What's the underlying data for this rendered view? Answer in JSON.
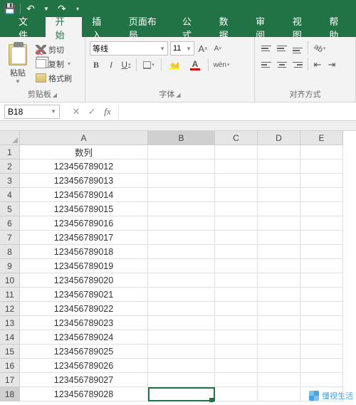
{
  "titlebar": {
    "save_icon": "💾",
    "undo_icon": "↶",
    "redo_icon": "↷"
  },
  "tabs": {
    "file": "文件",
    "home": "开始",
    "insert": "插入",
    "page_layout": "页面布局",
    "formulas": "公式",
    "data": "数据",
    "review": "审阅",
    "view": "视图",
    "help": "帮助"
  },
  "ribbon": {
    "clipboard": {
      "paste": "粘贴",
      "cut": "剪切",
      "copy": "复制",
      "format_painter": "格式刷",
      "label": "剪贴板"
    },
    "font": {
      "name": "等线",
      "size": "11",
      "label": "字体",
      "increase": "A",
      "decrease": "A",
      "bold": "B",
      "italic": "I",
      "underline": "U",
      "phonetic": "wén"
    },
    "alignment": {
      "label": "对齐方式"
    }
  },
  "namebox": "B18",
  "formula_bar": "",
  "grid": {
    "columns": [
      "A",
      "B",
      "C",
      "D",
      "E"
    ],
    "row_numbers": [
      1,
      2,
      3,
      4,
      5,
      6,
      7,
      8,
      9,
      10,
      11,
      12,
      13,
      14,
      15,
      16,
      17,
      18
    ],
    "header_cell": "数列",
    "col_a_values": [
      "123456789012",
      "123456789013",
      "123456789014",
      "123456789015",
      "123456789016",
      "123456789017",
      "123456789018",
      "123456789019",
      "123456789020",
      "123456789021",
      "123456789022",
      "123456789023",
      "123456789024",
      "123456789025",
      "123456789026",
      "123456789027",
      "123456789028"
    ],
    "selected_row": 18,
    "selected_col": "B"
  },
  "watermark": "懂视生活"
}
